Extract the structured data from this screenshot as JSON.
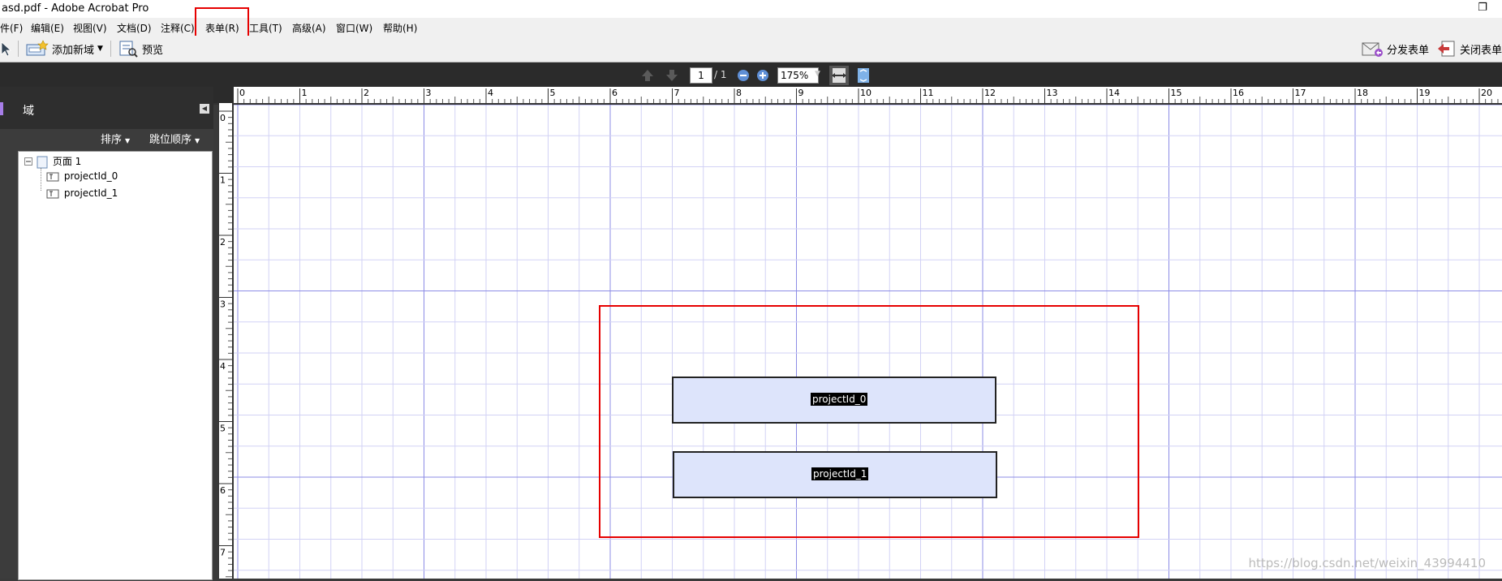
{
  "window": {
    "title": "asd.pdf - Adobe Acrobat Pro",
    "restore_glyph": "❐"
  },
  "menu": [
    {
      "label": "件(F)"
    },
    {
      "label": "编辑(E)"
    },
    {
      "label": "视图(V)"
    },
    {
      "label": "文档(D)"
    },
    {
      "label": "注释(C)"
    },
    {
      "label": "表单(R)"
    },
    {
      "label": "工具(T)"
    },
    {
      "label": "高级(A)"
    },
    {
      "label": "窗口(W)"
    },
    {
      "label": "帮助(H)"
    }
  ],
  "toolbar": {
    "add_field": "添加新域",
    "preview": "预览",
    "distribute": "分发表单",
    "close_form": "关闭表单"
  },
  "nav": {
    "current_page": "1",
    "total_pages": "/ 1",
    "zoom": "175%"
  },
  "panel": {
    "title": "域",
    "sort": "排序",
    "tab_order": "跳位顺序",
    "tree": {
      "page": "页面 1",
      "fields": [
        "projectId_0",
        "projectId_1"
      ]
    }
  },
  "ruler": {
    "h_ticks": [
      "0",
      "1",
      "2",
      "3",
      "4",
      "5",
      "6",
      "7",
      "8",
      "9",
      "10",
      "11",
      "12",
      "13",
      "14",
      "15",
      "16",
      "17",
      "18",
      "19",
      "20"
    ],
    "v_ticks": [
      "0",
      "1",
      "2",
      "3",
      "4",
      "5",
      "6",
      "7"
    ]
  },
  "canvas": {
    "fields": [
      {
        "label": "projectId_0"
      },
      {
        "label": "projectId_1"
      }
    ],
    "watermark": "https://blog.csdn.net/weixin_43994410"
  },
  "colors": {
    "highlight_red": "#e60000",
    "field_fill": "#dde4fb",
    "grid_major": "#8c8ce6",
    "grid_minor": "#d2d2f5"
  }
}
